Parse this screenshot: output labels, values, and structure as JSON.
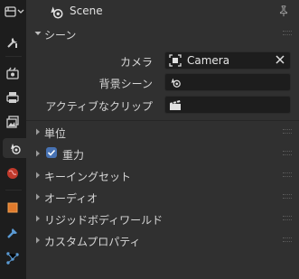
{
  "header": {
    "title": "Scene"
  },
  "panels": {
    "scene": {
      "label": "シーン"
    },
    "units": {
      "label": "単位"
    },
    "gravity": {
      "label": "重力",
      "checked": true
    },
    "keying_sets": {
      "label": "キーイングセット"
    },
    "audio": {
      "label": "オーディオ"
    },
    "rigid_body_world": {
      "label": "リジッドボディワールド"
    },
    "custom_props": {
      "label": "カスタムプロパティ"
    }
  },
  "props": {
    "camera": {
      "label": "カメラ",
      "value": "Camera"
    },
    "background_scene": {
      "label": "背景シーン",
      "value": ""
    },
    "active_clip": {
      "label": "アクティブなクリップ",
      "value": ""
    }
  },
  "colors": {
    "accent": "#4772b3",
    "panel_bg": "#303030",
    "tab_bg": "#1d1d1d",
    "field_bg": "#1d1d1d"
  },
  "icons": [
    "editor-type-icon",
    "scene-icon",
    "pin-icon",
    "tool-icon",
    "render-icon",
    "output-icon",
    "view-layer-icon",
    "scene-tab-icon",
    "world-icon",
    "object-icon",
    "modifier-icon",
    "particles-icon",
    "camera-icon",
    "clear-icon",
    "movie-clip-icon"
  ]
}
